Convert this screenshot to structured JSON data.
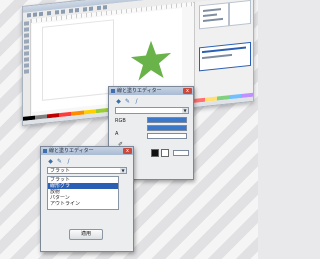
{
  "colors": {
    "star": "#6ab24a",
    "selection": "#2b5fb3",
    "blue_field": "#3b78c9",
    "palette": [
      "#000000",
      "#7f7f7f",
      "#c00000",
      "#ff3b3b",
      "#ff8c00",
      "#ffd000",
      "#9acd32",
      "#2ea043",
      "#00a0a0",
      "#1e6fd9",
      "#2040a0",
      "#8a2be2",
      "#d23c8c",
      "#ffffff",
      "#ff7070",
      "#ffe070",
      "#80d080",
      "#70c0ff",
      "#c090ff"
    ]
  },
  "main_window": {
    "icons": [
      "pointer-tool-icon",
      "node-tool-icon",
      "zoom-tool-icon",
      "rect-tool-icon",
      "ellipse-tool-icon",
      "star-tool-icon",
      "pen-tool-icon",
      "text-tool-icon",
      "fill-tool-icon"
    ]
  },
  "dialog_front": {
    "title": "線と塗りエディター",
    "close": "x",
    "tools": [
      "◆",
      "✎",
      "/"
    ],
    "combo": "フラット",
    "list_items": [
      "フラット",
      "線形グラ",
      "放射",
      "パターン",
      "アウトライン"
    ],
    "selected_index": 1,
    "button": "適用"
  },
  "dialog_back": {
    "title": "線と塗りエディター",
    "close": "x",
    "tools": [
      "◆",
      "✎",
      "/"
    ],
    "combo": "",
    "label_a": "RGB",
    "label_b": "A"
  }
}
